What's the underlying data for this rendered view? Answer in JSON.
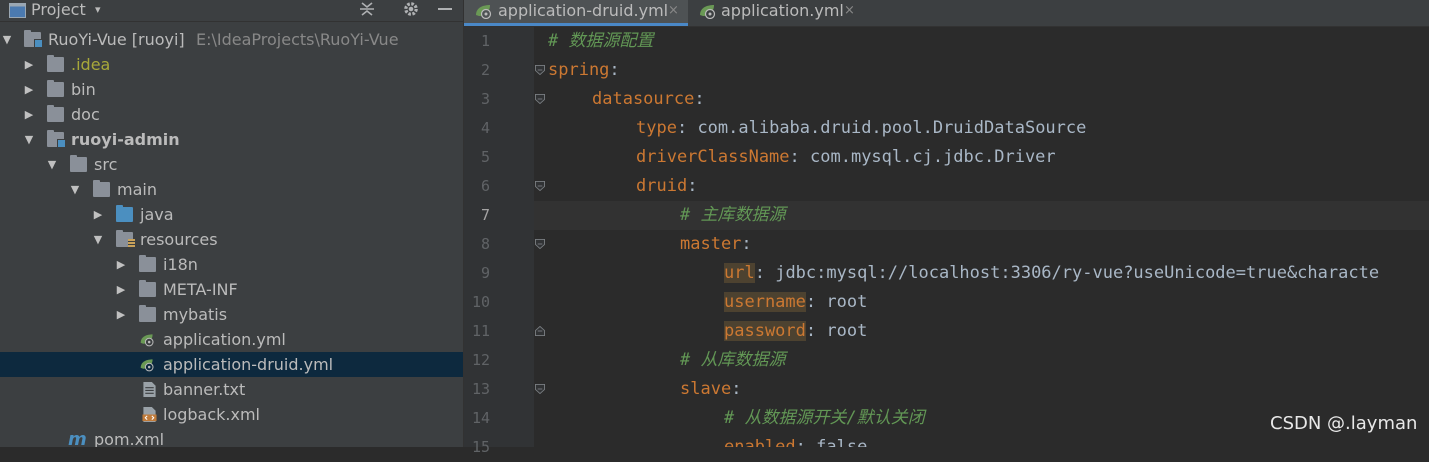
{
  "project_panel": {
    "title": "Project",
    "dropdown": "▾"
  },
  "tree": [
    {
      "label": "RuoYi-Vue [ruoyi]",
      "path": "E:\\IdeaProjects\\RuoYi-Vue",
      "icon": "module-folder-icon",
      "expanded": true
    },
    {
      "label": ".idea",
      "icon": "folder-icon",
      "expanded": false
    },
    {
      "label": "bin",
      "icon": "folder-icon",
      "expanded": false
    },
    {
      "label": "doc",
      "icon": "folder-icon",
      "expanded": false
    },
    {
      "label": "ruoyi-admin",
      "icon": "module-folder-icon",
      "expanded": true
    },
    {
      "label": "src",
      "icon": "folder-icon",
      "expanded": true
    },
    {
      "label": "main",
      "icon": "folder-icon",
      "expanded": true
    },
    {
      "label": "java",
      "icon": "source-folder-icon",
      "expanded": false
    },
    {
      "label": "resources",
      "icon": "resources-folder-icon",
      "expanded": true
    },
    {
      "label": "i18n",
      "icon": "folder-icon",
      "expanded": false
    },
    {
      "label": "META-INF",
      "icon": "folder-icon",
      "expanded": false
    },
    {
      "label": "mybatis",
      "icon": "folder-icon",
      "expanded": false
    },
    {
      "label": "application.yml",
      "icon": "spring-yml-icon"
    },
    {
      "label": "application-druid.yml",
      "icon": "spring-yml-icon",
      "selected": true
    },
    {
      "label": "banner.txt",
      "icon": "text-file-icon"
    },
    {
      "label": "logback.xml",
      "icon": "xml-file-icon"
    },
    {
      "label": "pom.xml",
      "icon": "maven-icon"
    }
  ],
  "tabs": [
    {
      "label": "application-druid.yml",
      "close": "×",
      "active": true
    },
    {
      "label": "application.yml",
      "close": "×",
      "active": false
    }
  ],
  "code": {
    "line_numbers": [
      "1",
      "2",
      "3",
      "4",
      "5",
      "6",
      "7",
      "8",
      "9",
      "10",
      "11",
      "12",
      "13",
      "14",
      "15"
    ],
    "current_line": "7",
    "lines": [
      {
        "comment": "# 数据源配置"
      },
      {
        "key": "spring",
        "colon": ":"
      },
      {
        "key": "datasource",
        "colon": ":"
      },
      {
        "key": "type",
        "colon": ": ",
        "value": "com.alibaba.druid.pool.DruidDataSource"
      },
      {
        "key": "driverClassName",
        "colon": ": ",
        "value": "com.mysql.cj.jdbc.Driver"
      },
      {
        "key": "druid",
        "colon": ":"
      },
      {
        "comment": "# 主库数据源"
      },
      {
        "key": "master",
        "colon": ":"
      },
      {
        "key": "url",
        "colon": ": ",
        "value": "jdbc:mysql://localhost:3306/ry-vue?useUnicode=true&characte"
      },
      {
        "key": "username",
        "colon": ": ",
        "value": "root"
      },
      {
        "key": "password",
        "colon": ": ",
        "value": "root"
      },
      {
        "comment": "# 从库数据源"
      },
      {
        "key": "slave",
        "colon": ":"
      },
      {
        "comment": "# 从数据源开关/默认关闭"
      },
      {
        "key": "enabled",
        "colon": ": ",
        "value": "false"
      }
    ]
  },
  "watermark": "CSDN @.layman",
  "colors": {
    "keyword": "#cc7832",
    "comment": "#629755",
    "value": "#a9b7c6",
    "selection": "#0d293e",
    "tab_accent": "#4a88c7"
  }
}
